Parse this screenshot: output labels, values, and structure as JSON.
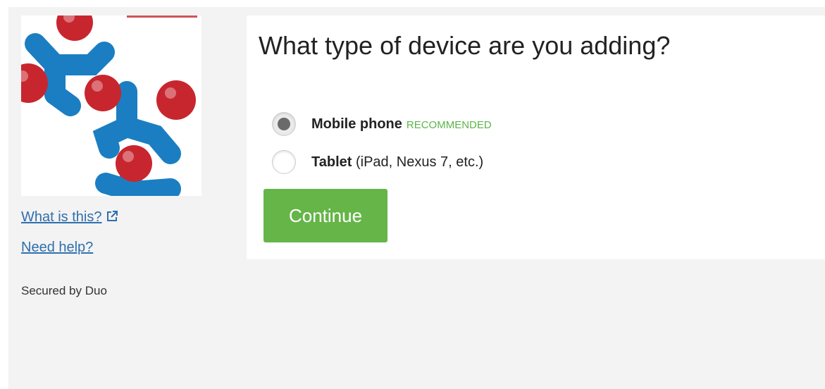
{
  "sidebar": {
    "links": [
      {
        "label": "What is this?",
        "icon": "external-link-icon"
      },
      {
        "label": "Need help?"
      }
    ],
    "secured_text": "Secured by Duo",
    "logo": {
      "colors": {
        "blue": "#1b7ec2",
        "red": "#c8262e"
      }
    }
  },
  "main": {
    "title": "What type of device are you adding?",
    "options": [
      {
        "label": "Mobile phone",
        "badge": "RECOMMENDED",
        "checked": true
      },
      {
        "label": "Tablet",
        "detail": " (iPad, Nexus 7, etc.)",
        "checked": false
      }
    ],
    "continue_label": "Continue"
  },
  "colors": {
    "accent_green": "#65b548",
    "link_blue": "#2f6fad",
    "recommended_green": "#5db54a"
  }
}
